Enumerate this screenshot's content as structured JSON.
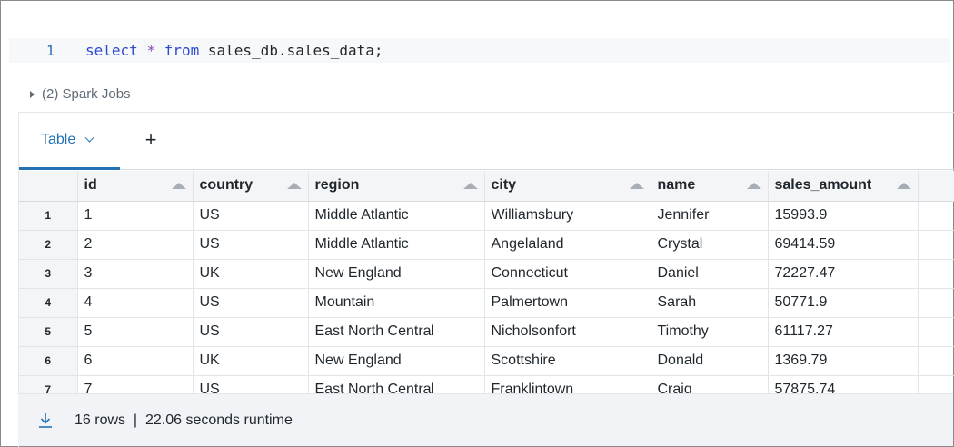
{
  "editor": {
    "line_number": "1",
    "tokens": [
      {
        "text": "select",
        "kind": "kw"
      },
      {
        "text": " ",
        "kind": "plain"
      },
      {
        "text": "*",
        "kind": "op"
      },
      {
        "text": " ",
        "kind": "plain"
      },
      {
        "text": "from",
        "kind": "kw"
      },
      {
        "text": " sales_db.sales_data;",
        "kind": "plain"
      }
    ]
  },
  "spark_jobs": {
    "label": "(2) Spark Jobs",
    "icon": "caret-right-icon"
  },
  "tabs": {
    "active_label": "Table",
    "dropdown_icon": "chevron-down-icon",
    "add_label": "+"
  },
  "table": {
    "columns": [
      "id",
      "country",
      "region",
      "city",
      "name",
      "sales_amount"
    ],
    "rows": [
      [
        "1",
        "US",
        "Middle Atlantic",
        "Williamsbury",
        "Jennifer",
        "15993.9"
      ],
      [
        "2",
        "US",
        "Middle Atlantic",
        "Angelaland",
        "Crystal",
        "69414.59"
      ],
      [
        "3",
        "UK",
        "New England",
        "Connecticut",
        "Daniel",
        "72227.47"
      ],
      [
        "4",
        "US",
        "Mountain",
        "Palmertown",
        "Sarah",
        "50771.9"
      ],
      [
        "5",
        "US",
        "East North Central",
        "Nicholsonfort",
        "Timothy",
        "61117.27"
      ],
      [
        "6",
        "UK",
        "New England",
        "Scottshire",
        "Donald",
        "1369.79"
      ],
      [
        "7",
        "US",
        "East North Central",
        "Franklintown",
        "Craig",
        "57875.74"
      ]
    ],
    "row_numbers": [
      "1",
      "2",
      "3",
      "4",
      "5",
      "6",
      "7"
    ]
  },
  "footer": {
    "summary": "16 rows  |  22.06 seconds runtime",
    "download_icon": "download-icon"
  },
  "colors": {
    "accent": "#2272b4",
    "keyword": "#2d4ad0",
    "operator": "#8a4ab8"
  }
}
